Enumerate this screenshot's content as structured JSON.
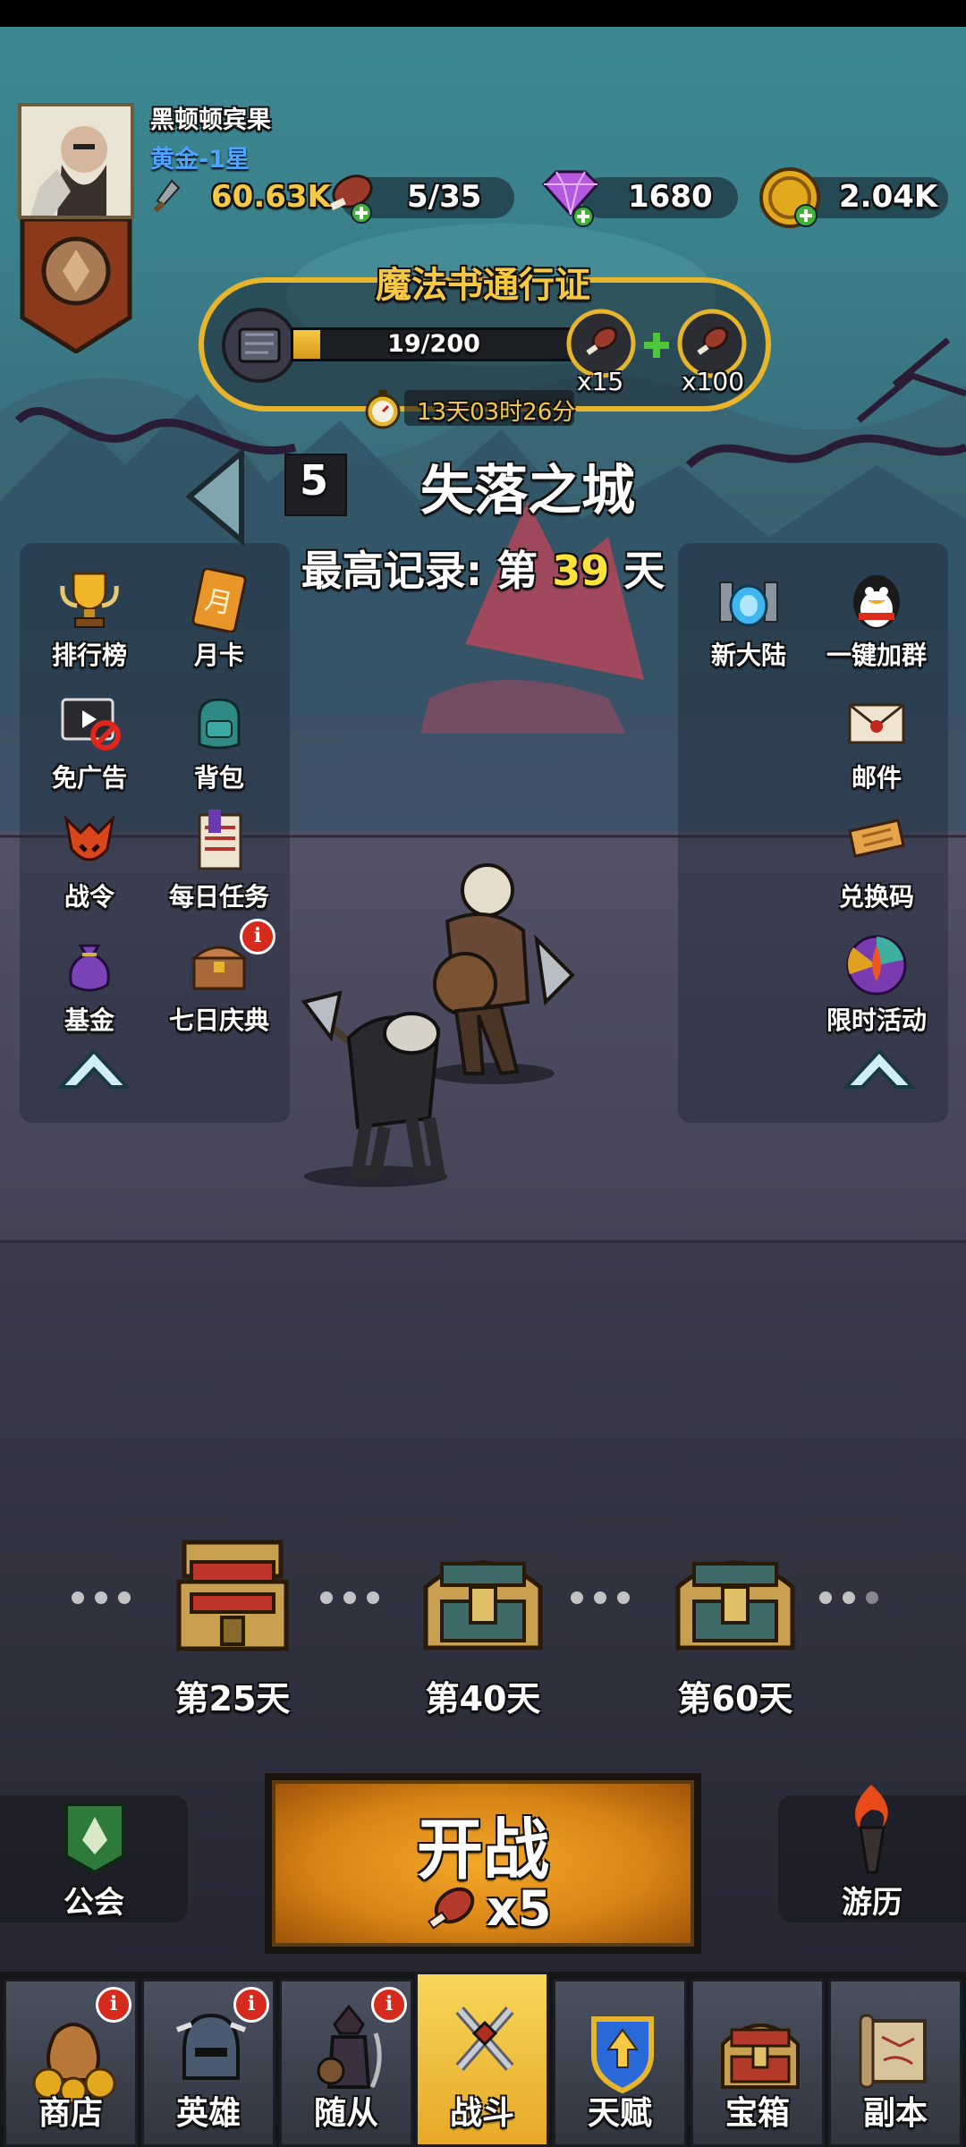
{
  "player": {
    "name": "黑顿顿宾果",
    "rank": "黄金-1星"
  },
  "stats": {
    "power": "60.63K",
    "stamina": "5/35",
    "gems": "1680",
    "coins": "2.04K"
  },
  "pass": {
    "title": "魔法书通行证",
    "progress_text": "19/200",
    "progress": 0.095,
    "reward1": "x15",
    "reward2": "x100",
    "timer": "13天03时26分"
  },
  "stage": {
    "number": "5",
    "name": "失落之城",
    "record_prefix": "最高记录: 第 ",
    "record_day": "39",
    "record_suffix": " 天"
  },
  "left_menu": [
    {
      "label": "排行榜",
      "icon": "trophy-icon"
    },
    {
      "label": "月卡",
      "icon": "month-card-icon",
      "glyph": "月"
    },
    {
      "label": "免广告",
      "icon": "no-ads-icon"
    },
    {
      "label": "背包",
      "icon": "backpack-icon"
    },
    {
      "label": "战令",
      "icon": "battle-order-icon"
    },
    {
      "label": "每日任务",
      "icon": "daily-task-icon"
    },
    {
      "label": "基金",
      "icon": "fund-bag-icon"
    },
    {
      "label": "七日庆典",
      "icon": "seven-day-chest-icon",
      "badge": "i"
    }
  ],
  "right_menu": [
    {
      "label": "新大陆",
      "icon": "new-continent-icon"
    },
    {
      "label": "一键加群",
      "icon": "qq-penguin-icon"
    },
    {
      "label": "邮件",
      "icon": "mail-icon"
    },
    {
      "label": "兑换码",
      "icon": "redeem-ticket-icon"
    },
    {
      "label": "限时活动",
      "icon": "event-wheel-icon"
    }
  ],
  "chests": [
    {
      "label": "第25天"
    },
    {
      "label": "第40天"
    },
    {
      "label": "第60天"
    }
  ],
  "guild_label": "公会",
  "travel_label": "游历",
  "start": {
    "label": "开战",
    "cost": "x5"
  },
  "tabs": [
    {
      "label": "商店",
      "icon": "shop-coins-icon",
      "badge": "i"
    },
    {
      "label": "英雄",
      "icon": "hero-helmet-icon",
      "badge": "i"
    },
    {
      "label": "随从",
      "icon": "follower-icon",
      "badge": "i"
    },
    {
      "label": "战斗",
      "icon": "crossed-swords-icon",
      "active": true
    },
    {
      "label": "天赋",
      "icon": "talent-shield-icon"
    },
    {
      "label": "宝箱",
      "icon": "treasure-chest-icon"
    },
    {
      "label": "副本",
      "icon": "scroll-map-icon"
    }
  ],
  "colors": {
    "gold": "#f6c945",
    "record_day": "#ffe23a",
    "rank": "#4da3ff",
    "active_tab": "#f4c43c"
  }
}
